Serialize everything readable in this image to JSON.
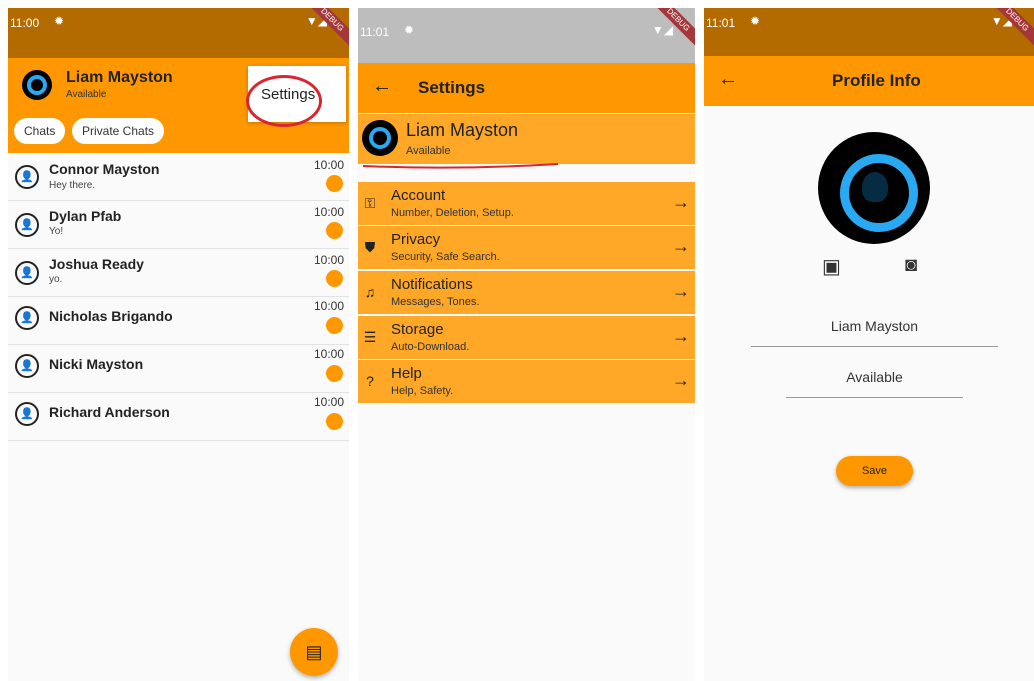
{
  "screen1": {
    "status": {
      "time": "11:00"
    },
    "debug_banner": "DEBUG",
    "profile": {
      "name": "Liam Mayston",
      "status": "Available"
    },
    "tabs": [
      "Chats",
      "Private Chats"
    ],
    "menu": {
      "item": "Settings"
    },
    "chats": [
      {
        "name": "Connor Mayston",
        "message": "Hey there.",
        "time": "10:00"
      },
      {
        "name": "Dylan Pfab",
        "message": "Yo!",
        "time": "10:00"
      },
      {
        "name": "Joshua Ready",
        "message": "yo.",
        "time": "10:00"
      },
      {
        "name": "Nicholas Brigando",
        "message": "",
        "time": "10:00"
      },
      {
        "name": "Nicki Mayston",
        "message": "",
        "time": "10:00"
      },
      {
        "name": "Richard Anderson",
        "message": "",
        "time": "10:00"
      }
    ]
  },
  "screen2": {
    "status": {
      "time": "11:01"
    },
    "debug_banner": "DEBUG",
    "title": "Settings",
    "profile": {
      "name": "Liam Mayston",
      "status": "Available"
    },
    "items": [
      {
        "title": "Account",
        "subtitle": "Number, Deletion, Setup.",
        "icon": "key-icon"
      },
      {
        "title": "Privacy",
        "subtitle": "Security, Safe Search.",
        "icon": "shield-icon"
      },
      {
        "title": "Notifications",
        "subtitle": "Messages, Tones.",
        "icon": "bell-icon"
      },
      {
        "title": "Storage",
        "subtitle": "Auto-Download.",
        "icon": "storage-icon"
      },
      {
        "title": "Help",
        "subtitle": "Help, Safety.",
        "icon": "help-icon"
      }
    ]
  },
  "screen3": {
    "status": {
      "time": "11:01"
    },
    "debug_banner": "DEBUG",
    "title": "Profile Info",
    "name_value": "Liam Mayston",
    "status_value": "Available",
    "save_label": "Save"
  },
  "colors": {
    "accent": "#ff9800",
    "settings_row": "#ffa726",
    "annotation": "#d9262e",
    "avatar_ring": "#29a9f2"
  }
}
